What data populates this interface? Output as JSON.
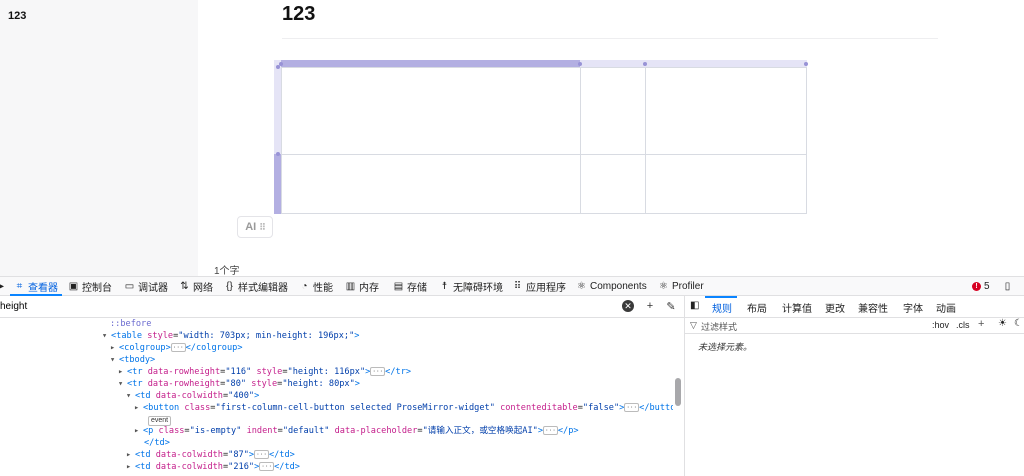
{
  "sidebar": {
    "title": "123"
  },
  "document": {
    "title": "123",
    "ai_button": "AI",
    "word_count": "1个字"
  },
  "devtools": {
    "tabs": [
      {
        "label": "查看器",
        "icon": "inspector-icon"
      },
      {
        "label": "控制台",
        "icon": "console-icon"
      },
      {
        "label": "调试器",
        "icon": "debugger-icon"
      },
      {
        "label": "网络",
        "icon": "network-icon"
      },
      {
        "label": "样式编辑器",
        "icon": "style-editor-icon"
      },
      {
        "label": "性能",
        "icon": "performance-icon"
      },
      {
        "label": "内存",
        "icon": "memory-icon"
      },
      {
        "label": "存储",
        "icon": "storage-icon"
      },
      {
        "label": "无障碍环境",
        "icon": "accessibility-icon"
      },
      {
        "label": "应用程序",
        "icon": "application-icon"
      },
      {
        "label": "Components",
        "icon": "react-icon"
      },
      {
        "label": "Profiler",
        "icon": "react-icon"
      }
    ],
    "error_count": "5",
    "search": {
      "value": "height"
    },
    "rules_tabs": [
      "规则",
      "布局",
      "计算值",
      "更改",
      "兼容性",
      "字体",
      "动画"
    ],
    "filter_placeholder": "过滤样式",
    "hov_label": ":hov",
    "cls_label": ".cls",
    "no_element_text": "未选择元素。",
    "colors": {
      "accent": "#0a84ff",
      "selected_grip": "#b3afe2",
      "grip": "#e5e4f6"
    }
  },
  "markup": {
    "before": "::before",
    "table_open": {
      "tag": "table",
      "attr": "style",
      "value": "width: 703px; min-height: 196px;"
    },
    "colgroup": {
      "open": "<colgroup>",
      "close": "</colgroup>"
    },
    "tbody": "<tbody>",
    "tr1": {
      "attr1": "data-rowheight",
      "val1": "116",
      "attr2": "style",
      "val2": "height: 116px"
    },
    "tr2": {
      "attr1": "data-rowheight",
      "val1": "80",
      "attr2": "style",
      "val2": "height: 80px"
    },
    "td1": {
      "attr": "data-colwidth",
      "val": "400"
    },
    "button": {
      "attr1": "class",
      "val1": "first-column-cell-button selected ProseMirror-widget",
      "attr2": "contenteditable",
      "val2": "false",
      "event": "event"
    },
    "p": {
      "attr1": "class",
      "val1": "is-empty",
      "attr2": "indent",
      "val2": "default",
      "attr3": "data-placeholder",
      "val3": "请输入正文，或空格唤起AI"
    },
    "td_close": "</td>",
    "td2": {
      "attr": "data-colwidth",
      "val": "87"
    },
    "td3": {
      "attr": "data-colwidth",
      "val": "216"
    }
  }
}
